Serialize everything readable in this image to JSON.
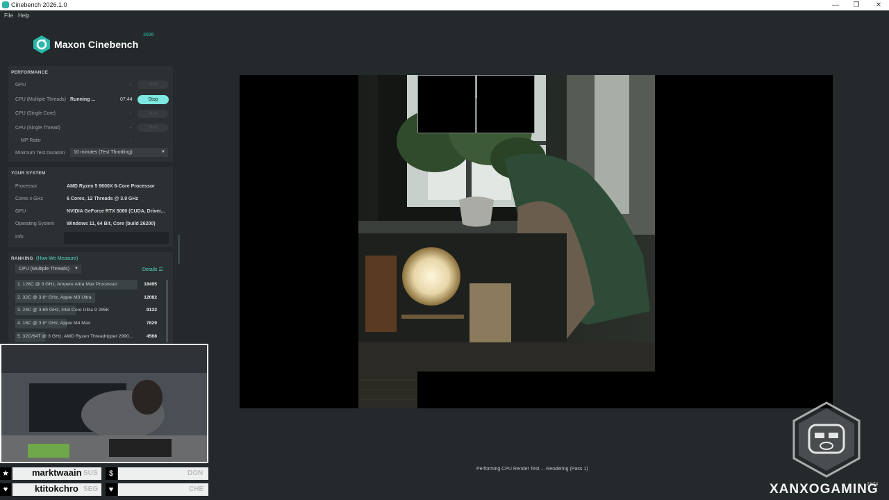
{
  "window": {
    "title": "Cinebench 2026.1.0",
    "minimize": "—",
    "maximize": "❐",
    "close": "✕"
  },
  "menu": {
    "file": "File",
    "help": "Help"
  },
  "brand": {
    "name": "Maxon Cinebench",
    "version": "2026",
    "accent": "#30c7b8"
  },
  "performance": {
    "section_title": "PERFORMANCE",
    "tests": [
      {
        "label": "GPU",
        "status": "",
        "time": "-",
        "button": "Start"
      },
      {
        "label": "CPU (Multiple Threads)",
        "status": "Running ...",
        "time": "07:44",
        "button": "Stop"
      },
      {
        "label": "CPU (Single Core)",
        "status": "",
        "time": "-",
        "button": "Start"
      },
      {
        "label": "CPU (Single Thread)",
        "status": "",
        "time": "-",
        "button": "Start"
      }
    ],
    "mp_ratio": {
      "label": "MP Ratio",
      "value": "-"
    },
    "min_duration": {
      "label": "Minimum Test Duration",
      "value": "10 minutes (Test Throttling)"
    }
  },
  "system": {
    "section_title": "YOUR SYSTEM",
    "rows": [
      {
        "label": "Processor",
        "value": "AMD Ryzen 5 9600X 6-Core Processor"
      },
      {
        "label": "Cores x GHz",
        "value": "6 Cores, 12 Threads @ 3.9 GHz"
      },
      {
        "label": "GPU",
        "value": "NVIDIA GeForce RTX 5060 (CUDA, Driver..."
      },
      {
        "label": "Operating System",
        "value": "Windows 11, 64 Bit, Core (build 26200)"
      },
      {
        "label": "Info",
        "value": ""
      }
    ]
  },
  "ranking": {
    "section_title": "RANKING",
    "how_link": "(How We Measure)",
    "filter": "CPU (Multiple Threads)",
    "details": "Details",
    "rows": [
      {
        "name": "1. 128C @ 3 GHz, Ampere Altra Max Processor",
        "score": "18495",
        "fraction": 1.0
      },
      {
        "name": "2. 32C @ 3.6* GHz, Apple M3 Ultra",
        "score": "12082",
        "fraction": 0.653
      },
      {
        "name": "3. 24C @ 3.69 GHz, Intel Core Ultra 9 285K",
        "score": "9132",
        "fraction": 0.494
      },
      {
        "name": "4. 16C @ 3.9* GHz, Apple M4 Max",
        "score": "7829",
        "fraction": 0.423
      },
      {
        "name": "5. 32C/64T @ 3 GHz, AMD Ryzen Threadripper 2990...",
        "score": "4568",
        "fraction": 0.247
      }
    ]
  },
  "render": {
    "status": "Performing CPU Render Test ... Rendering (Pass 1)"
  },
  "overlay": {
    "chat": [
      {
        "icon": "★",
        "name": "marktwaain",
        "tag": "SUS"
      },
      {
        "icon": "$",
        "name": "",
        "tag": "DON"
      },
      {
        "icon": "♥",
        "name": "ktitokchro",
        "tag": "SEG"
      },
      {
        "icon": "♥",
        "name": "",
        "tag": "CHE"
      }
    ],
    "watermark": "XANXOGAMING",
    "clock": "23:74"
  }
}
